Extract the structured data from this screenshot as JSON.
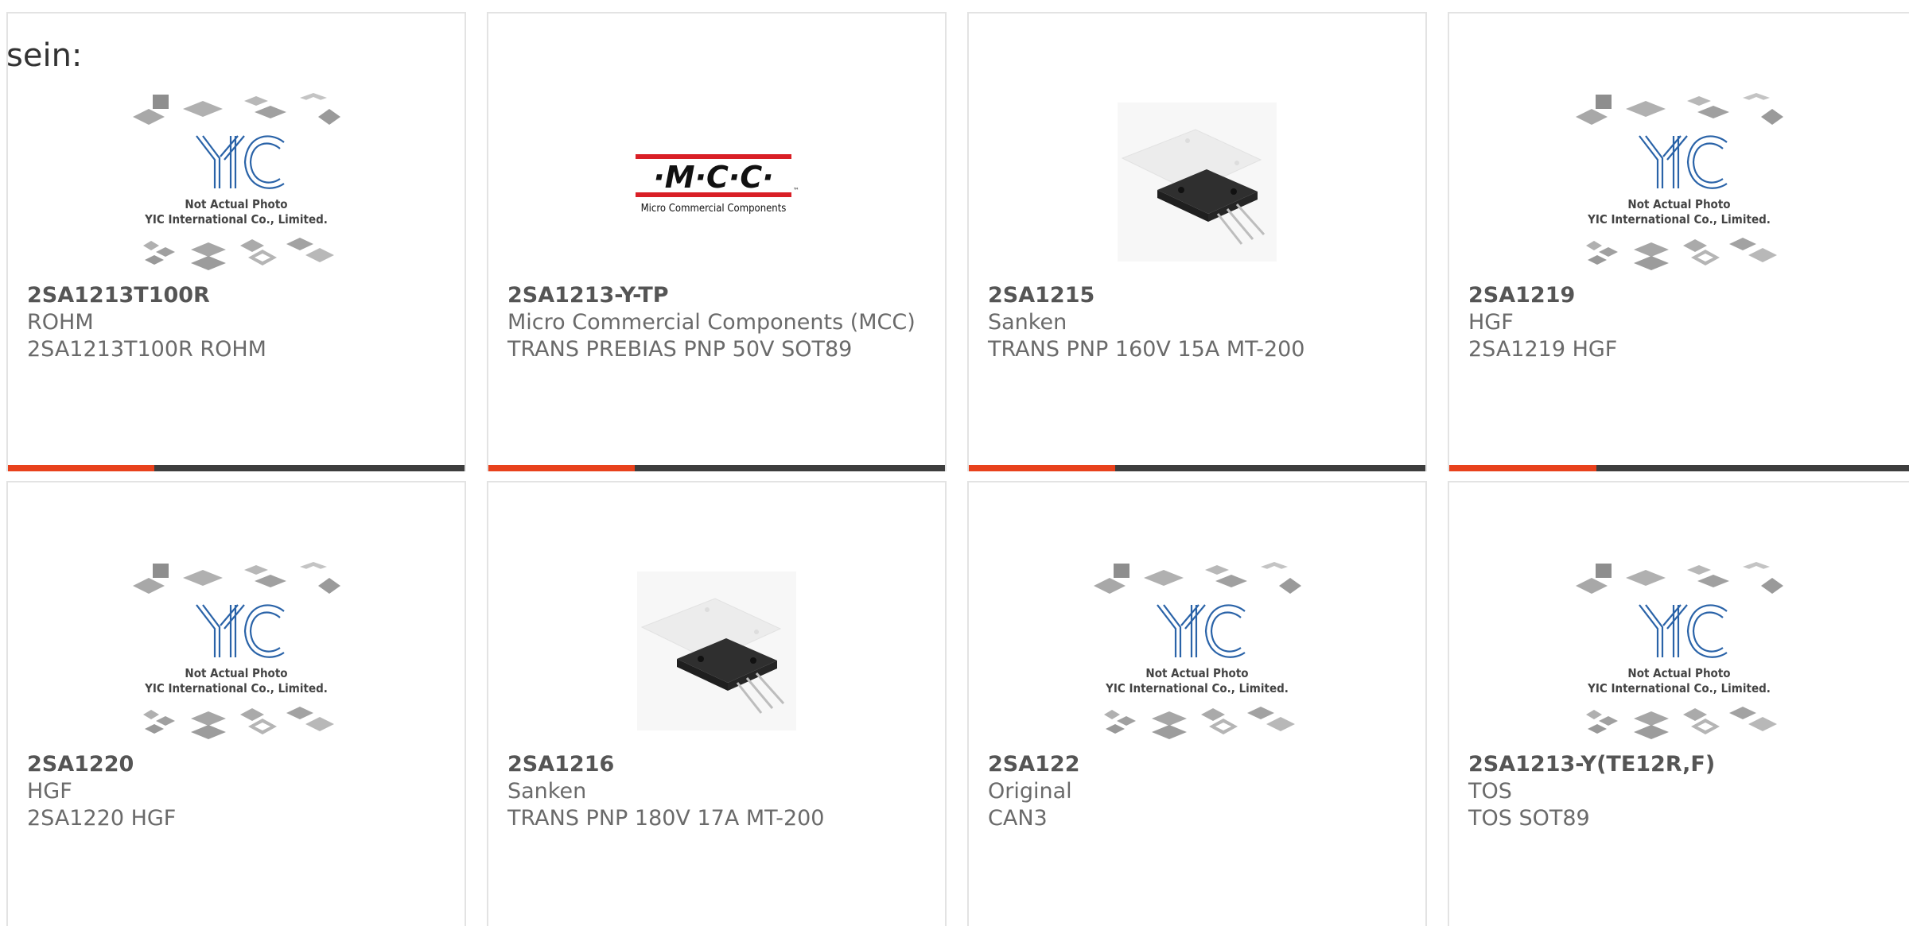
{
  "page": {
    "fragment_text": "sein:"
  },
  "colors": {
    "accent": "#e8411c",
    "bar": "#3d3d3d",
    "yic_blue": "#2a63a8"
  },
  "placeholder": {
    "line1": "Not Actual Photo",
    "line2": "YIC International Co., Limited."
  },
  "mcc_logo": {
    "mark": "·M·C·C·",
    "tm": "™",
    "subtitle": "Micro Commercial Components"
  },
  "products": [
    {
      "part_number": "2SA1213T100R",
      "manufacturer": "ROHM",
      "description": "2SA1213T100R ROHM",
      "image": "yic-placeholder"
    },
    {
      "part_number": "2SA1213-Y-TP",
      "manufacturer": "Micro Commercial Components (MCC)",
      "description": "TRANS PREBIAS PNP 50V SOT89",
      "image": "mcc-logo"
    },
    {
      "part_number": "2SA1215",
      "manufacturer": "Sanken",
      "description": "TRANS PNP 160V 15A MT-200",
      "image": "transistor-photo"
    },
    {
      "part_number": "2SA1219",
      "manufacturer": "HGF",
      "description": "2SA1219 HGF",
      "image": "yic-placeholder"
    },
    {
      "part_number": "2SA1220",
      "manufacturer": "HGF",
      "description": "2SA1220 HGF",
      "image": "yic-placeholder"
    },
    {
      "part_number": "2SA1216",
      "manufacturer": "Sanken",
      "description": "TRANS PNP 180V 17A MT-200",
      "image": "transistor-photo"
    },
    {
      "part_number": "2SA122",
      "manufacturer": "Original",
      "description": "CAN3",
      "image": "yic-placeholder"
    },
    {
      "part_number": "2SA1213-Y(TE12R,F)",
      "manufacturer": "TOS",
      "description": "TOS SOT89",
      "image": "yic-placeholder"
    }
  ]
}
